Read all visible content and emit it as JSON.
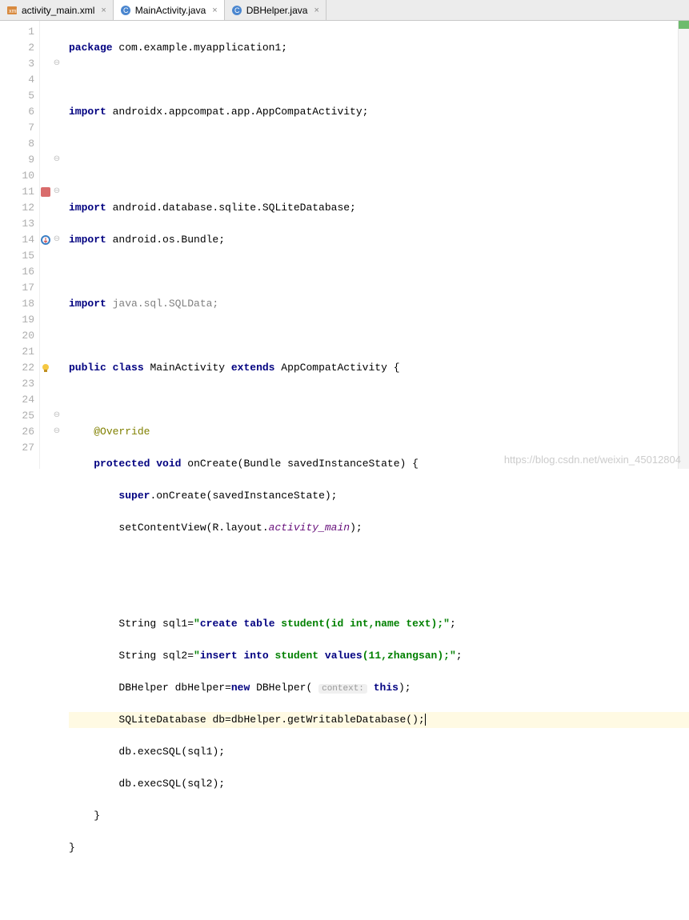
{
  "tabs": [
    {
      "label": "activity_main.xml",
      "icon": "xml",
      "active": false
    },
    {
      "label": "MainActivity.java",
      "icon": "class",
      "active": true
    },
    {
      "label": "DBHelper.java",
      "icon": "class",
      "active": false
    }
  ],
  "lines": {
    "count": 27
  },
  "code": {
    "l1": {
      "kw_package": "package",
      "pkg": " com.example.myapplication1;"
    },
    "l3": {
      "kw_import": "import",
      "pkg": " androidx.appcompat.app.AppCompatActivity;"
    },
    "l6": {
      "kw_import": "import",
      "pkg": " android.database.sqlite.SQLiteDatabase;"
    },
    "l7": {
      "kw_import": "import",
      "pkg": " android.os.Bundle;"
    },
    "l9": {
      "kw_import": "import",
      "gray": " java.sql.SQLData;"
    },
    "l11": {
      "kw_public": "public",
      "kw_class": "class",
      "name": " MainActivity ",
      "kw_extends": "extends",
      "sup": " AppCompatActivity {"
    },
    "l13": {
      "ann": "@Override"
    },
    "l14": {
      "kw_protected": "protected",
      "kw_void": "void",
      "m": " onCreate(Bundle savedInstanceState) {"
    },
    "l15": {
      "kw_super": "super",
      "rest": ".onCreate(savedInstanceState);"
    },
    "l16": {
      "a": "setContentView(R.layout.",
      "ital": "activity_main",
      "b": ");"
    },
    "l19": {
      "a": "String sql1=",
      "str": "\"create table student(id int,name text);\"",
      "b": ";"
    },
    "l20": {
      "a": "String sql2=",
      "str": "\"insert into student values(11,zhangsan);\"",
      "b": ";"
    },
    "l21": {
      "a": "DBHelper dbHelper=",
      "kw_new": "new",
      "b": " DBHelper( ",
      "hint": "context:",
      "kw_this": "this",
      "c": ");"
    },
    "l22": {
      "a": "SQLiteDatabase db=dbHelper.getWritableDatabase();"
    },
    "l23": {
      "a": "db.execSQL(sql1);"
    },
    "l24": {
      "a": "db.execSQL(sql2);"
    },
    "l25": {
      "a": "}"
    },
    "l26": {
      "a": "}"
    }
  },
  "keywords_in_sql1": {
    "create": "create",
    "table": "table"
  },
  "keywords_in_sql2": {
    "insert": "insert",
    "into": "into",
    "values": "values"
  },
  "watermark": "https://blog.csdn.net/weixin_45012804"
}
